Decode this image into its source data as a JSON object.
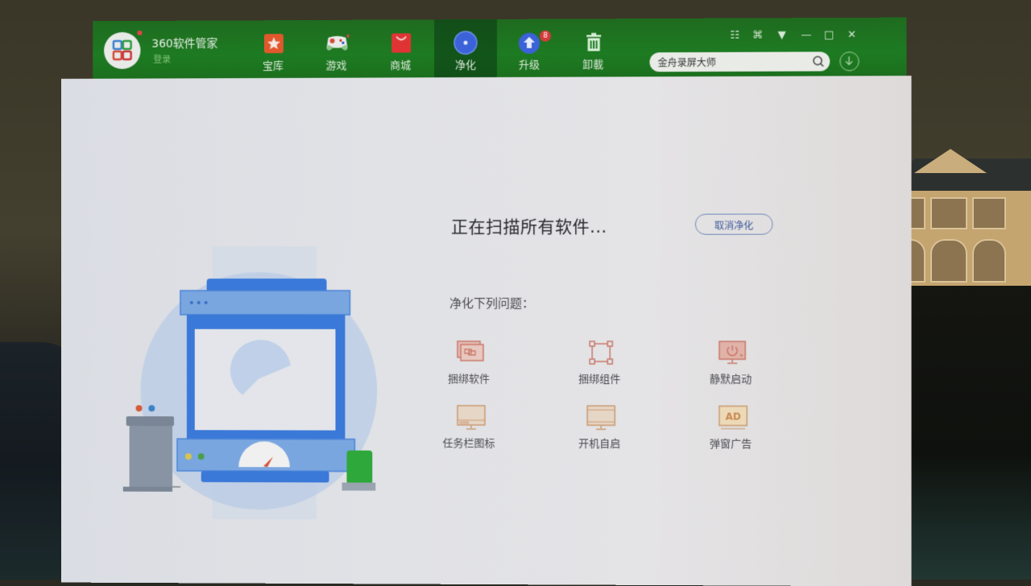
{
  "app": {
    "title": "360软件管家",
    "login_label": "登录"
  },
  "nav": {
    "items": [
      {
        "label": "宝库",
        "icon": "treasure-star-icon",
        "color": "#e0582c"
      },
      {
        "label": "游戏",
        "icon": "gamepad-icon",
        "color": "#e8ebe8"
      },
      {
        "label": "商城",
        "icon": "shopping-bag-icon",
        "color": "#e03434"
      },
      {
        "label": "净化",
        "icon": "purify-disc-icon",
        "color": "#3b62d8",
        "active": true
      },
      {
        "label": "升级",
        "icon": "upgrade-arrow-icon",
        "color": "#3b62d8",
        "badge": "8"
      },
      {
        "label": "卸載",
        "icon": "trash-icon",
        "color": "#d6eed6"
      }
    ]
  },
  "window_controls": [
    "grid-icon",
    "skin-icon",
    "menu-icon",
    "minimize-icon",
    "maximize-icon",
    "close-icon"
  ],
  "search": {
    "value": "金舟录屏大师",
    "placeholder": ""
  },
  "main": {
    "scan_status": "正在扫描所有软件...",
    "cancel_label": "取消净化",
    "issues_heading": "净化下列问题：",
    "issues": [
      {
        "label": "捆绑软件",
        "icon": "bundled-software-icon"
      },
      {
        "label": "捆绑组件",
        "icon": "bundled-component-icon"
      },
      {
        "label": "静默启动",
        "icon": "silent-start-icon"
      },
      {
        "label": "任务栏图标",
        "icon": "taskbar-icon"
      },
      {
        "label": "开机自启",
        "icon": "autostart-icon"
      },
      {
        "label": "弹窗广告",
        "icon": "popup-ad-icon",
        "glyph": "AD"
      }
    ]
  },
  "colors": {
    "titlebar": "#1d7b22",
    "accent_blue": "#3b62d8",
    "issue_icon": "#c98a7a"
  }
}
